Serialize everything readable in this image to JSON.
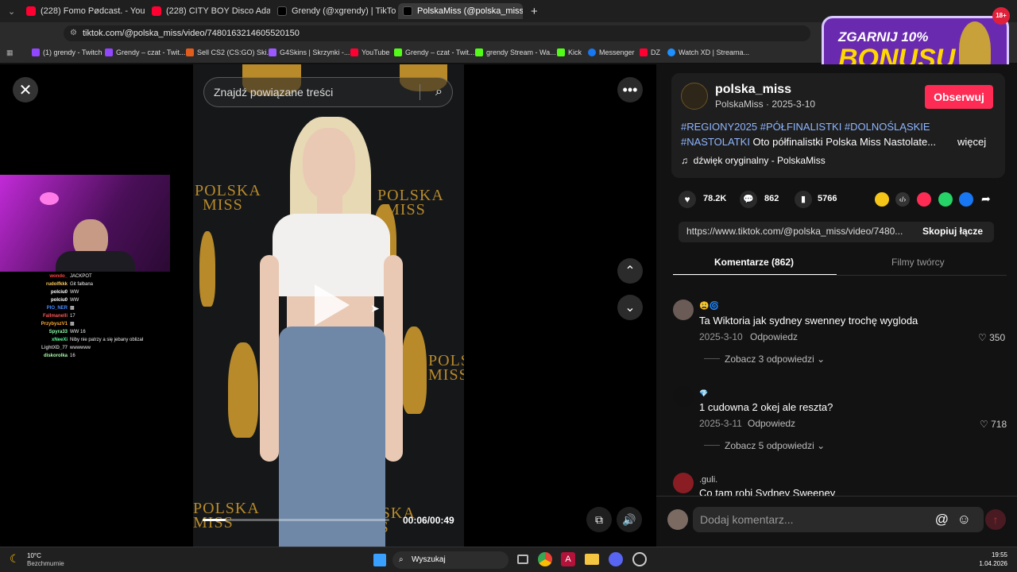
{
  "browser": {
    "tabs": [
      {
        "title": "(228) Fomo Pødcast. - YouTube",
        "icon": "youtube-icon",
        "color": "#ff0033"
      },
      {
        "title": "(228) CITY BOY Disco Adamus 'ł",
        "icon": "youtube-icon",
        "color": "#ff0033"
      },
      {
        "title": "Grendy (@xgrendy) | TikTok",
        "icon": "tiktok-icon",
        "color": "#ffffff"
      },
      {
        "title": "PolskaMiss (@polska_miss) | Tik",
        "icon": "tiktok-icon",
        "color": "#ffffff"
      }
    ],
    "url": "tiktok.com/@polska_miss/video/7480163214605520150",
    "bookmarks": [
      {
        "label": "(1) grendy - Twitch",
        "color": "#9146ff"
      },
      {
        "label": "Grendy – czat - Twit...",
        "color": "#9146ff"
      },
      {
        "label": "Sell CS2 (CS:GO) Ski...",
        "color": "#e25c1c"
      },
      {
        "label": "G4Skins | Skrzynki -...",
        "color": "#9b59ff"
      },
      {
        "label": "YouTube",
        "color": "#ff0033"
      },
      {
        "label": "Grendy – czat - Twit...",
        "color": "#53fc18"
      },
      {
        "label": "grendy Stream - Wa...",
        "color": "#53fc18"
      },
      {
        "label": "Kick",
        "color": "#53fc18"
      },
      {
        "label": "Messenger",
        "color": "#1877f2"
      },
      {
        "label": "DZ",
        "color": "#ff0033"
      },
      {
        "label": "Watch XD | Streama...",
        "color": "#1e90ff"
      }
    ]
  },
  "ad": {
    "line1": "ZGARNIJ 10%",
    "line2": "BONUSU",
    "badge": "18+"
  },
  "video": {
    "search_placeholder": "Znajdź powiązane treści",
    "logo_text_1": "POLSKA",
    "logo_text_2": "MISS",
    "time": "00:06/00:49",
    "progress": 0.122
  },
  "stream_chat": [
    {
      "user": "wondo_",
      "msg": "JACKPOT",
      "color": "#ff4444"
    },
    {
      "user": "rudolfkkk",
      "msg": "Git fałbana",
      "color": "#ffcc55"
    },
    {
      "user": "polciu0",
      "msg": "WW",
      "color": "#ffffff"
    },
    {
      "user": "polciu0",
      "msg": "WW",
      "color": "#ffffff"
    },
    {
      "user": "PIO_NER",
      "msg": "▩",
      "color": "#4488ff"
    },
    {
      "user": "Fallmanelli",
      "msg": "17",
      "color": "#ff5555"
    },
    {
      "user": "PrzybyszV1",
      "msg": "▩",
      "color": "#ffaa33"
    },
    {
      "user": "Spyra33",
      "msg": "WW 16",
      "color": "#88ffaa"
    },
    {
      "user": "xNeeXi",
      "msg": "Niby nie patrzy a się jebany oblizał",
      "color": "#55ff99"
    },
    {
      "user": "LightXD_77",
      "msg": "wwwwww",
      "color": "#bbbbbb"
    },
    {
      "user": "diskorolka",
      "msg": "16",
      "color": "#aaffaa"
    }
  ],
  "post": {
    "username": "polska_miss",
    "nick": "PolskaMiss",
    "date": "2025-3-10",
    "nick_date": "PolskaMiss · 2025-3-10",
    "follow": "Obserwuj",
    "hashtags_1": "#REGIONY2025 #PÓŁFINALISTKI #DOLNOŚLĄSKIE",
    "hashtags_2": "#NASTOLATKI",
    "desc": " Oto półfinalistki Polska Miss Nastolate...",
    "more": "więcej",
    "sound": "dźwięk oryginalny - PolskaMiss",
    "likes": "78.2K",
    "comments": "862",
    "saves": "5766",
    "link": "https://www.tiktok.com/@polska_miss/video/7480...",
    "copy": "Skopiuj łącze"
  },
  "tabs": {
    "comments": "Komentarze (862)",
    "creator": "Filmy twórcy"
  },
  "comments": [
    {
      "text": "Ta Wiktoria jak sydney swenney trochę wygloda",
      "date": "2025-3-10",
      "reply": "Odpowiedz",
      "likes": "350",
      "view": "Zobacz 3 odpowiedzi"
    },
    {
      "text": "1 cudowna 2 okej ale reszta?",
      "date": "2025-3-11",
      "reply": "Odpowiedz",
      "likes": "718",
      "view": "Zobacz 5 odpowiedzi"
    },
    {
      "user": ".guli.",
      "text": "Co tam robi Sydney Sweeney"
    }
  ],
  "comment_input": {
    "placeholder": "Dodaj komentarz..."
  },
  "taskbar": {
    "weather_temp": "10°C",
    "weather_desc": "Bezchmurnie",
    "search": "Wyszukaj",
    "time": "19:55",
    "date": "1.04.2026"
  }
}
